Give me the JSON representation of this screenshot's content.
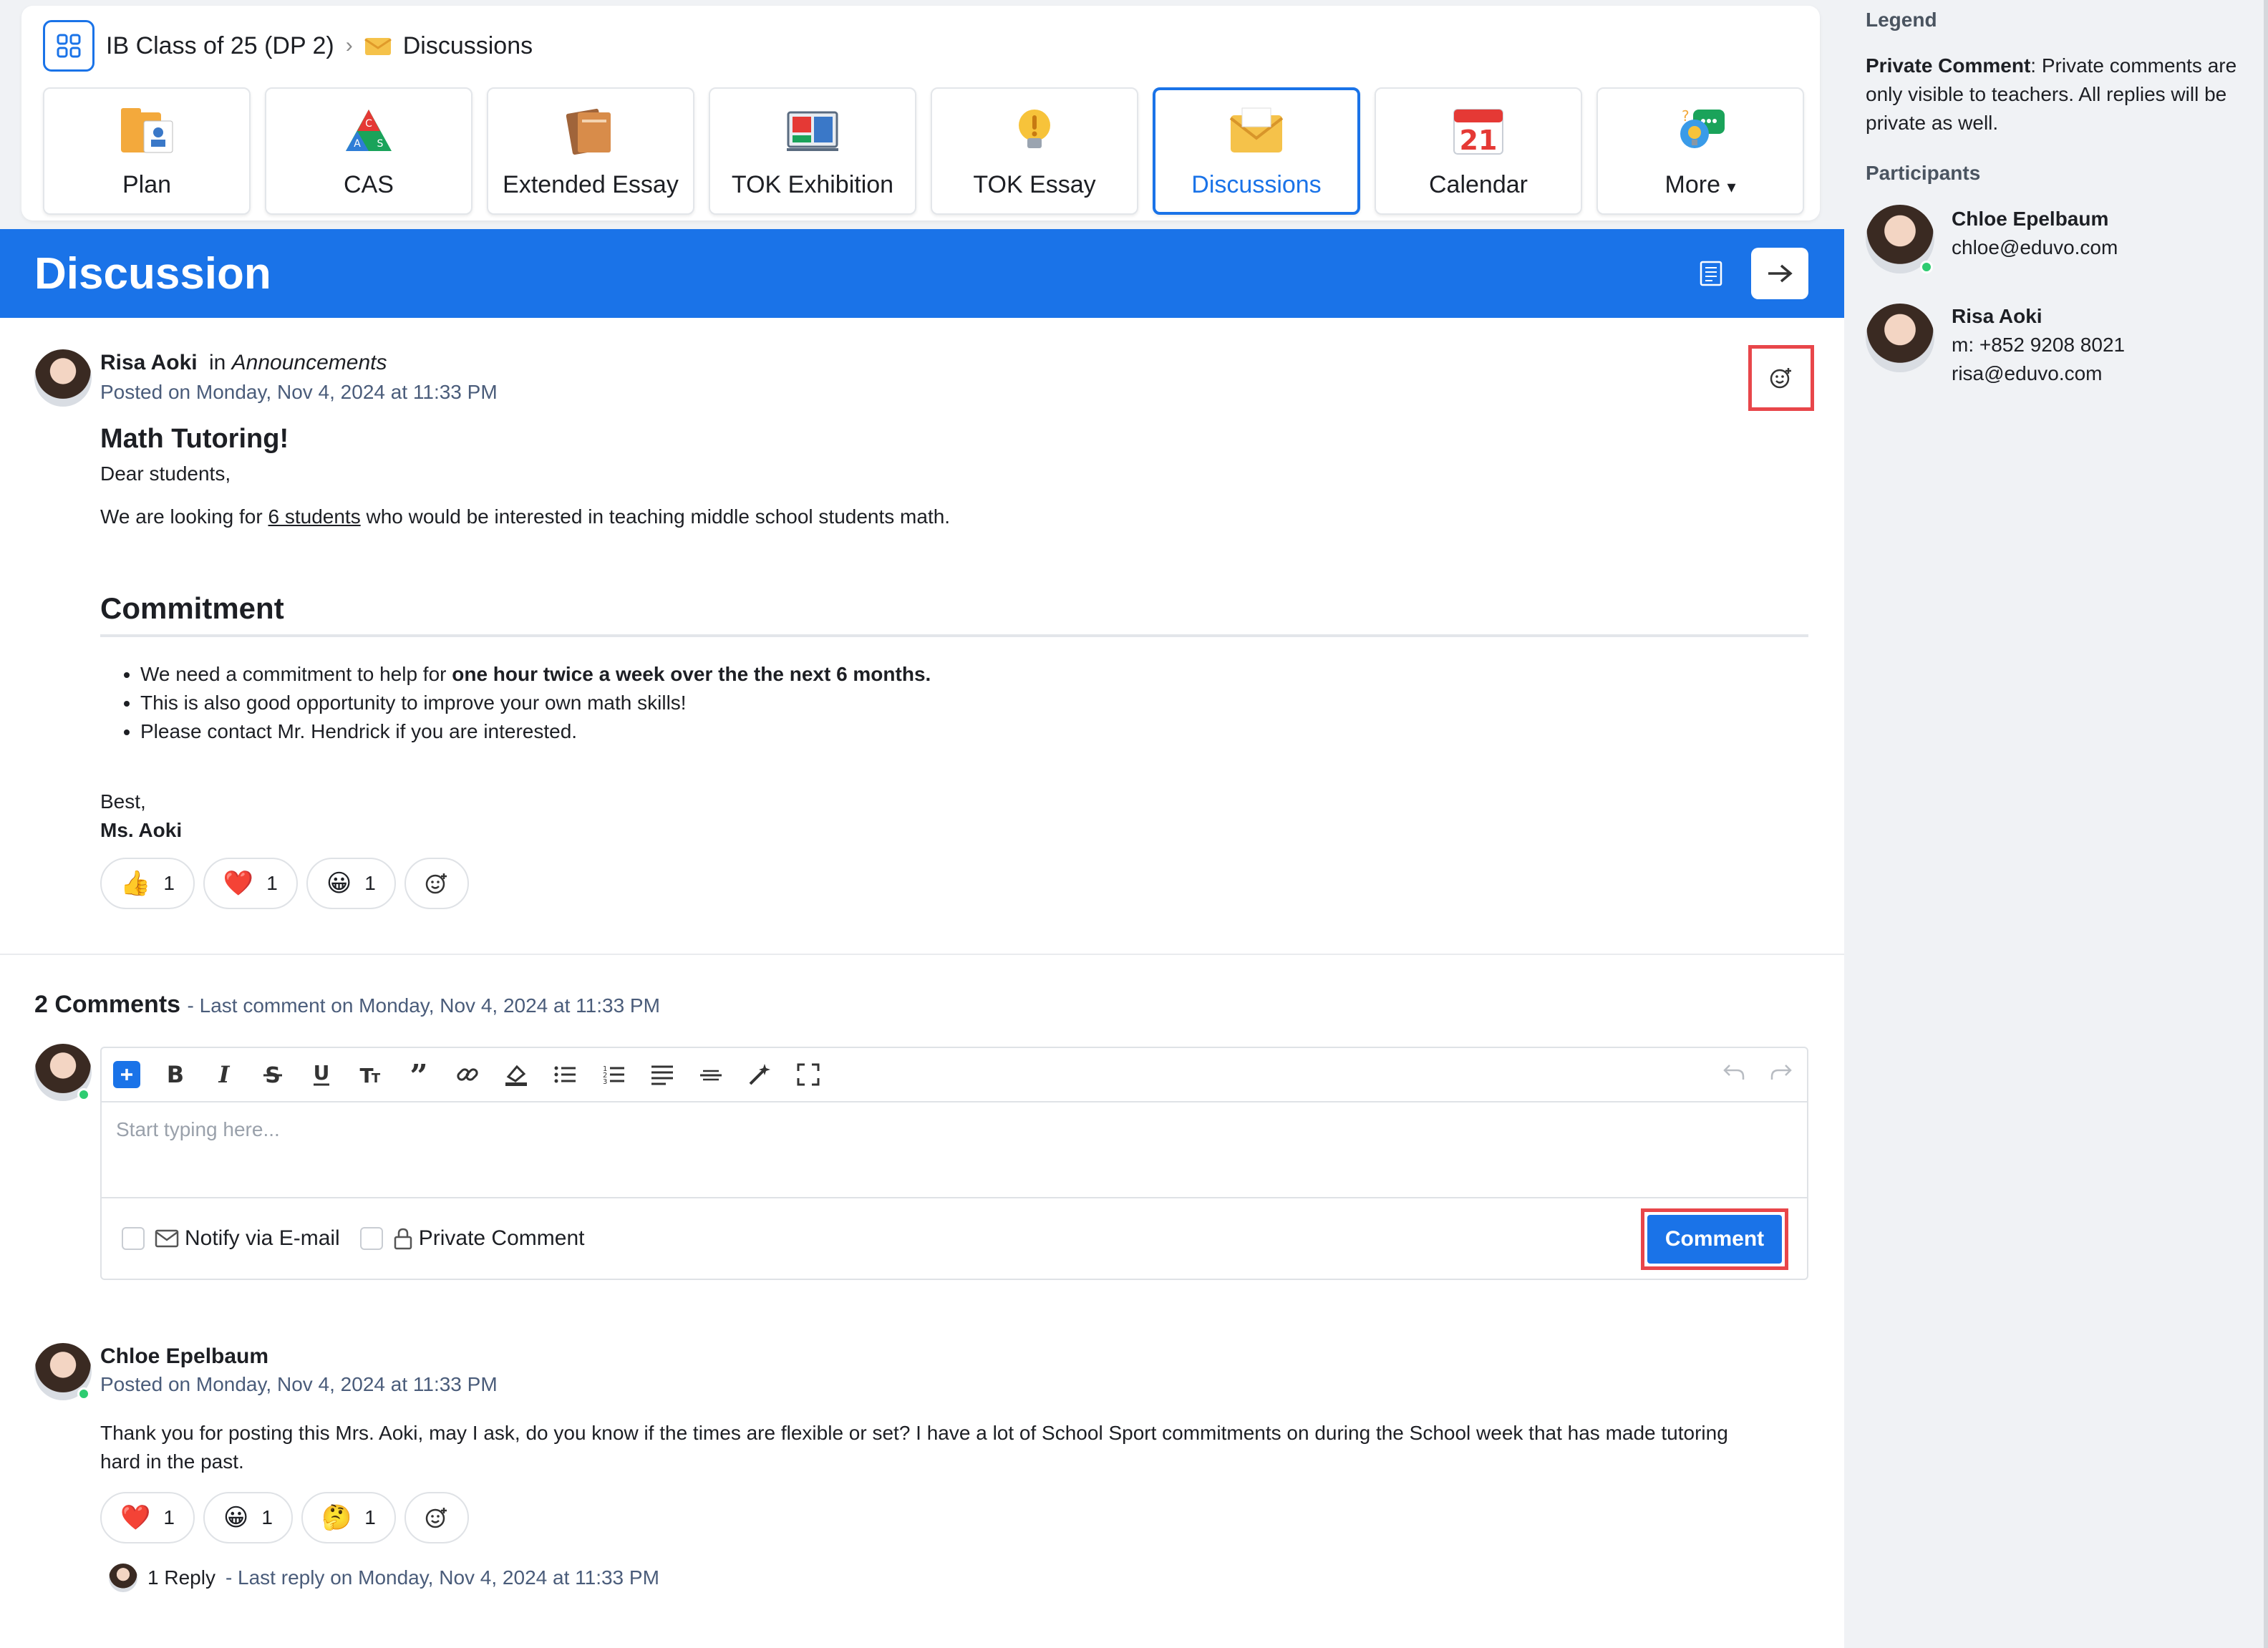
{
  "breadcrumb": {
    "course": "IB Class of 25 (DP 2)",
    "separator": "›",
    "page": "Discussions"
  },
  "tiles": [
    {
      "label": "Plan",
      "icon": "plan-icon",
      "active": false
    },
    {
      "label": "CAS",
      "icon": "cas-icon",
      "active": false
    },
    {
      "label": "Extended Essay",
      "icon": "extended-essay-icon",
      "active": false
    },
    {
      "label": "TOK Exhibition",
      "icon": "tok-exhibition-icon",
      "active": false
    },
    {
      "label": "TOK Essay",
      "icon": "tok-essay-icon",
      "active": false
    },
    {
      "label": "Discussions",
      "icon": "discussions-icon",
      "active": true
    },
    {
      "label": "Calendar",
      "icon": "calendar-icon",
      "active": false,
      "day": "21"
    },
    {
      "label": "More",
      "icon": "more-icon",
      "active": false,
      "caret": "▾"
    }
  ],
  "header": {
    "title": "Discussion"
  },
  "post": {
    "author": "Risa Aoki",
    "in_label": "in",
    "category": "Announcements",
    "posted": "Posted on Monday, Nov 4, 2024 at 11:33 PM",
    "title": "Math Tutoring!",
    "greeting": "Dear students,",
    "intro_before": "We are looking for ",
    "intro_link": "6 students",
    "intro_after": " who would be interested in teaching middle school students math.",
    "section_title": "Commitment",
    "bullet1_before": "We need a commitment to help for ",
    "bullet1_bold": "one hour twice a week over the the next 6 months.",
    "bullet2": "This is also good opportunity to improve your own math skills!",
    "bullet3": "Please contact Mr. Hendrick if you are interested.",
    "signoff": "Best,",
    "signature": "Ms. Aoki",
    "reactions": [
      {
        "emoji": "👍",
        "count": "1"
      },
      {
        "emoji": "❤️",
        "count": "1"
      },
      {
        "emoji": "😀",
        "count": "1"
      }
    ]
  },
  "comments": {
    "count_label": "2 Comments",
    "last_comment": "- Last comment on Monday, Nov 4, 2024 at 11:33 PM",
    "editor_placeholder": "Start typing here...",
    "notify_label": "Notify via E-mail",
    "private_label": "Private Comment",
    "submit_label": "Comment"
  },
  "comment1": {
    "author": "Chloe Epelbaum",
    "posted": "Posted on Monday, Nov 4, 2024 at 11:33 PM",
    "text": "Thank you for posting this Mrs. Aoki, may I ask, do you know if the times are flexible or set? I have a lot of School Sport commitments on during the School week that has made tutoring hard in the past.",
    "reactions": [
      {
        "emoji": "❤️",
        "count": "1"
      },
      {
        "emoji": "😀",
        "count": "1"
      },
      {
        "emoji": "🤔",
        "count": "1"
      }
    ],
    "reply_count": "1 Reply",
    "reply_meta": "- Last reply on Monday, Nov 4, 2024 at 11:33 PM"
  },
  "sidebar": {
    "legend_title": "Legend",
    "legend_term": "Private Comment",
    "legend_text": ": Private comments are only visible to teachers. All replies will be private as well.",
    "participants_title": "Participants",
    "participants": [
      {
        "name": "Chloe Epelbaum",
        "email": "chloe@eduvo.com",
        "online": true
      },
      {
        "name": "Risa Aoki",
        "phone": "m: +852 9208 8021",
        "email": "risa@eduvo.com",
        "online": false
      }
    ]
  },
  "colors": {
    "accent": "#1a73e8",
    "highlight": "#e8464a",
    "online": "#2ecc71"
  }
}
